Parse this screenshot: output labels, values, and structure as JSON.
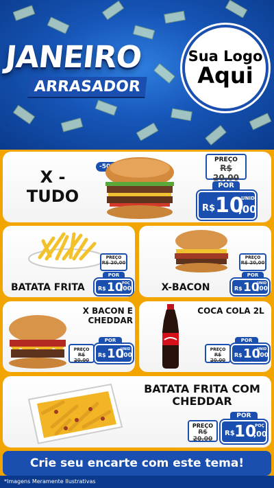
{
  "header": {
    "title": "JANEIRO",
    "subtitle": "ARRASADOR",
    "logo_line1": "Sua Logo",
    "logo_line2": "Aqui"
  },
  "products": [
    {
      "name": "X - TUDO",
      "discount_badge": "-50%",
      "preco_label": "PREÇO",
      "old_price": "R$ 20,00",
      "por_label": "POR",
      "currency": "R$",
      "price_int": "10",
      "price_dec": ",00",
      "unit": "UNID",
      "image_icon": "burger-icon"
    },
    {
      "name": "BATATA FRITA",
      "preco_label": "PREÇO",
      "old_price": "R$ 20,00",
      "por_label": "POR",
      "currency": "R$",
      "price_int": "10",
      "price_dec": ",00",
      "unit": "POÇ",
      "image_icon": "fries-icon"
    },
    {
      "name": "X-BACON",
      "preco_label": "PREÇO",
      "old_price": "R$ 20,00",
      "por_label": "POR",
      "currency": "R$",
      "price_int": "10",
      "price_dec": ",00",
      "unit": "UNID",
      "image_icon": "burger-icon"
    },
    {
      "name": "X BACON E CHEDDAR",
      "preco_label": "PREÇO",
      "old_price": "R$ 20,00",
      "por_label": "POR",
      "currency": "R$",
      "price_int": "10",
      "price_dec": ",00",
      "unit": "UNID",
      "image_icon": "burger-icon"
    },
    {
      "name": "COCA COLA 2L",
      "preco_label": "PREÇO",
      "old_price": "R$ 20,00",
      "por_label": "POR",
      "currency": "R$",
      "price_int": "10",
      "price_dec": ",00",
      "unit": "UNID",
      "image_icon": "soda-bottle-icon"
    },
    {
      "name": "BATATA FRITA COM CHEDDAR",
      "preco_label": "PREÇO",
      "old_price": "R$ 20,00",
      "por_label": "POR",
      "currency": "R$",
      "price_int": "10",
      "price_dec": ",00",
      "unit": "POÇ",
      "image_icon": "fries-cheddar-icon"
    }
  ],
  "footer": {
    "cta": "Crie seu encarte com este tema!",
    "disclaimer": "*Imagens Meramente Ilustrativas"
  },
  "colors": {
    "background": "#f2a400",
    "brand_blue": "#1a4fb0",
    "header_blue": "#1656b8",
    "card": "#ffffff"
  }
}
